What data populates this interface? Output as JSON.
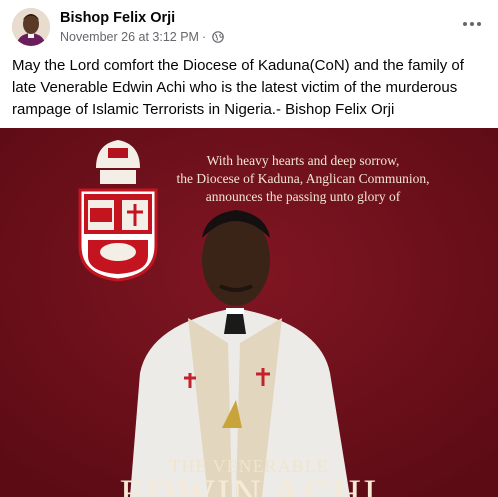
{
  "post": {
    "author": "Bishop Felix Orji",
    "date": "November 26 at 3:12 PM",
    "separator": "·",
    "privacy_icon": "globe-icon",
    "more_icon": "more-options-icon",
    "caption": "May the Lord comfort the Diocese of Kaduna(CoN) and the family of late Venerable Edwin Achi who is the latest victim of the murderous rampage of Islamic Terrorists in Nigeria.- Bishop Felix Orji"
  },
  "image": {
    "announcement": "With heavy hearts and deep sorrow,\nthe Diocese of Kaduna, Anglican Communion,\nannounces the passing unto glory of",
    "title_small": "THE VENERABLE",
    "title_big": "EDWIN ACHI",
    "background_color": "#6e0f1a"
  }
}
